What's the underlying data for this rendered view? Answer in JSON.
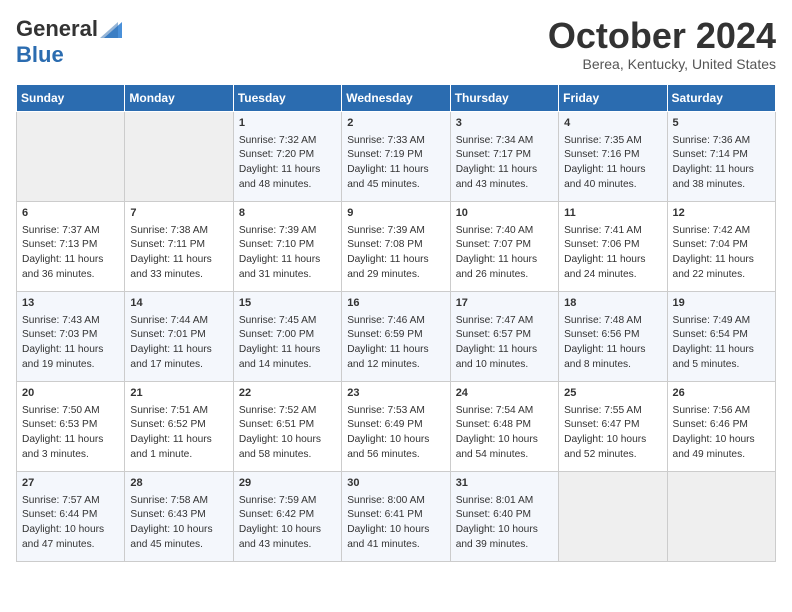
{
  "header": {
    "logo_line1": "General",
    "logo_line2": "Blue",
    "month": "October 2024",
    "location": "Berea, Kentucky, United States"
  },
  "days_of_week": [
    "Sunday",
    "Monday",
    "Tuesday",
    "Wednesday",
    "Thursday",
    "Friday",
    "Saturday"
  ],
  "weeks": [
    [
      {
        "day": "",
        "content": ""
      },
      {
        "day": "",
        "content": ""
      },
      {
        "day": "1",
        "content": "Sunrise: 7:32 AM\nSunset: 7:20 PM\nDaylight: 11 hours and 48 minutes."
      },
      {
        "day": "2",
        "content": "Sunrise: 7:33 AM\nSunset: 7:19 PM\nDaylight: 11 hours and 45 minutes."
      },
      {
        "day": "3",
        "content": "Sunrise: 7:34 AM\nSunset: 7:17 PM\nDaylight: 11 hours and 43 minutes."
      },
      {
        "day": "4",
        "content": "Sunrise: 7:35 AM\nSunset: 7:16 PM\nDaylight: 11 hours and 40 minutes."
      },
      {
        "day": "5",
        "content": "Sunrise: 7:36 AM\nSunset: 7:14 PM\nDaylight: 11 hours and 38 minutes."
      }
    ],
    [
      {
        "day": "6",
        "content": "Sunrise: 7:37 AM\nSunset: 7:13 PM\nDaylight: 11 hours and 36 minutes."
      },
      {
        "day": "7",
        "content": "Sunrise: 7:38 AM\nSunset: 7:11 PM\nDaylight: 11 hours and 33 minutes."
      },
      {
        "day": "8",
        "content": "Sunrise: 7:39 AM\nSunset: 7:10 PM\nDaylight: 11 hours and 31 minutes."
      },
      {
        "day": "9",
        "content": "Sunrise: 7:39 AM\nSunset: 7:08 PM\nDaylight: 11 hours and 29 minutes."
      },
      {
        "day": "10",
        "content": "Sunrise: 7:40 AM\nSunset: 7:07 PM\nDaylight: 11 hours and 26 minutes."
      },
      {
        "day": "11",
        "content": "Sunrise: 7:41 AM\nSunset: 7:06 PM\nDaylight: 11 hours and 24 minutes."
      },
      {
        "day": "12",
        "content": "Sunrise: 7:42 AM\nSunset: 7:04 PM\nDaylight: 11 hours and 22 minutes."
      }
    ],
    [
      {
        "day": "13",
        "content": "Sunrise: 7:43 AM\nSunset: 7:03 PM\nDaylight: 11 hours and 19 minutes."
      },
      {
        "day": "14",
        "content": "Sunrise: 7:44 AM\nSunset: 7:01 PM\nDaylight: 11 hours and 17 minutes."
      },
      {
        "day": "15",
        "content": "Sunrise: 7:45 AM\nSunset: 7:00 PM\nDaylight: 11 hours and 14 minutes."
      },
      {
        "day": "16",
        "content": "Sunrise: 7:46 AM\nSunset: 6:59 PM\nDaylight: 11 hours and 12 minutes."
      },
      {
        "day": "17",
        "content": "Sunrise: 7:47 AM\nSunset: 6:57 PM\nDaylight: 11 hours and 10 minutes."
      },
      {
        "day": "18",
        "content": "Sunrise: 7:48 AM\nSunset: 6:56 PM\nDaylight: 11 hours and 8 minutes."
      },
      {
        "day": "19",
        "content": "Sunrise: 7:49 AM\nSunset: 6:54 PM\nDaylight: 11 hours and 5 minutes."
      }
    ],
    [
      {
        "day": "20",
        "content": "Sunrise: 7:50 AM\nSunset: 6:53 PM\nDaylight: 11 hours and 3 minutes."
      },
      {
        "day": "21",
        "content": "Sunrise: 7:51 AM\nSunset: 6:52 PM\nDaylight: 11 hours and 1 minute."
      },
      {
        "day": "22",
        "content": "Sunrise: 7:52 AM\nSunset: 6:51 PM\nDaylight: 10 hours and 58 minutes."
      },
      {
        "day": "23",
        "content": "Sunrise: 7:53 AM\nSunset: 6:49 PM\nDaylight: 10 hours and 56 minutes."
      },
      {
        "day": "24",
        "content": "Sunrise: 7:54 AM\nSunset: 6:48 PM\nDaylight: 10 hours and 54 minutes."
      },
      {
        "day": "25",
        "content": "Sunrise: 7:55 AM\nSunset: 6:47 PM\nDaylight: 10 hours and 52 minutes."
      },
      {
        "day": "26",
        "content": "Sunrise: 7:56 AM\nSunset: 6:46 PM\nDaylight: 10 hours and 49 minutes."
      }
    ],
    [
      {
        "day": "27",
        "content": "Sunrise: 7:57 AM\nSunset: 6:44 PM\nDaylight: 10 hours and 47 minutes."
      },
      {
        "day": "28",
        "content": "Sunrise: 7:58 AM\nSunset: 6:43 PM\nDaylight: 10 hours and 45 minutes."
      },
      {
        "day": "29",
        "content": "Sunrise: 7:59 AM\nSunset: 6:42 PM\nDaylight: 10 hours and 43 minutes."
      },
      {
        "day": "30",
        "content": "Sunrise: 8:00 AM\nSunset: 6:41 PM\nDaylight: 10 hours and 41 minutes."
      },
      {
        "day": "31",
        "content": "Sunrise: 8:01 AM\nSunset: 6:40 PM\nDaylight: 10 hours and 39 minutes."
      },
      {
        "day": "",
        "content": ""
      },
      {
        "day": "",
        "content": ""
      }
    ]
  ]
}
